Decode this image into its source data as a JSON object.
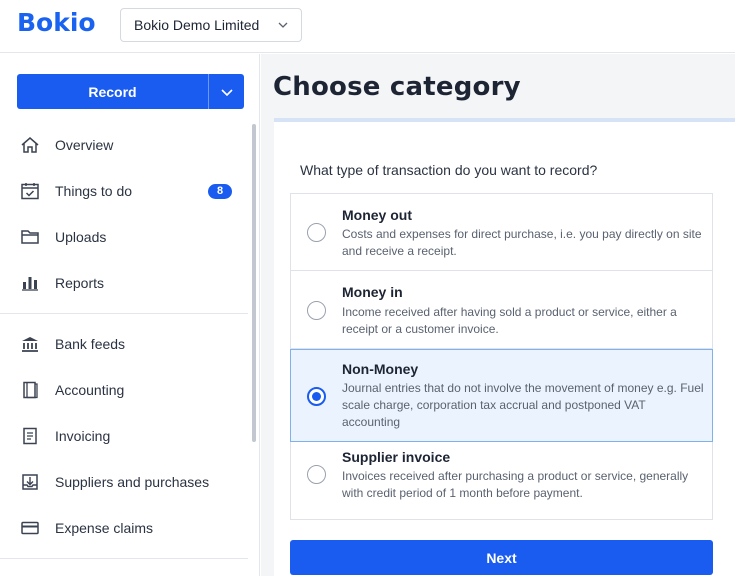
{
  "header": {
    "logo": "Bokio",
    "company_name": "Bokio Demo Limited"
  },
  "sidebar": {
    "record_label": "Record",
    "items": [
      {
        "label": "Overview",
        "icon": "home-icon"
      },
      {
        "label": "Things to do",
        "icon": "calendar-check-icon",
        "badge": "8"
      },
      {
        "label": "Uploads",
        "icon": "folder-icon"
      },
      {
        "label": "Reports",
        "icon": "bar-chart-icon"
      },
      {
        "label": "Bank feeds",
        "icon": "bank-icon"
      },
      {
        "label": "Accounting",
        "icon": "ledger-icon"
      },
      {
        "label": "Invoicing",
        "icon": "invoice-icon"
      },
      {
        "label": "Suppliers and purchases",
        "icon": "inbox-download-icon"
      },
      {
        "label": "Expense claims",
        "icon": "credit-card-icon"
      }
    ]
  },
  "main": {
    "title": "Choose category",
    "question": "What type of transaction do you want to record?",
    "options": [
      {
        "title": "Money out",
        "description": "Costs and expenses for direct purchase, i.e. you pay directly on site and receive a receipt.",
        "selected": false
      },
      {
        "title": "Money in",
        "description": "Income received after having sold a product or service, either a receipt or a customer invoice.",
        "selected": false
      },
      {
        "title": "Non-Money",
        "description": "Journal entries that do not involve the movement of money e.g. Fuel scale charge, corporation tax accrual and postponed VAT accounting",
        "selected": true
      },
      {
        "title": "Supplier invoice",
        "description": "Invoices received after purchasing a product or service, generally with credit period of 1 month before payment.",
        "selected": false
      }
    ],
    "next_label": "Next"
  },
  "colors": {
    "brand": "#1a5cf0",
    "selected_bg": "#ebf4fe",
    "selected_border": "#7fb1ea"
  }
}
